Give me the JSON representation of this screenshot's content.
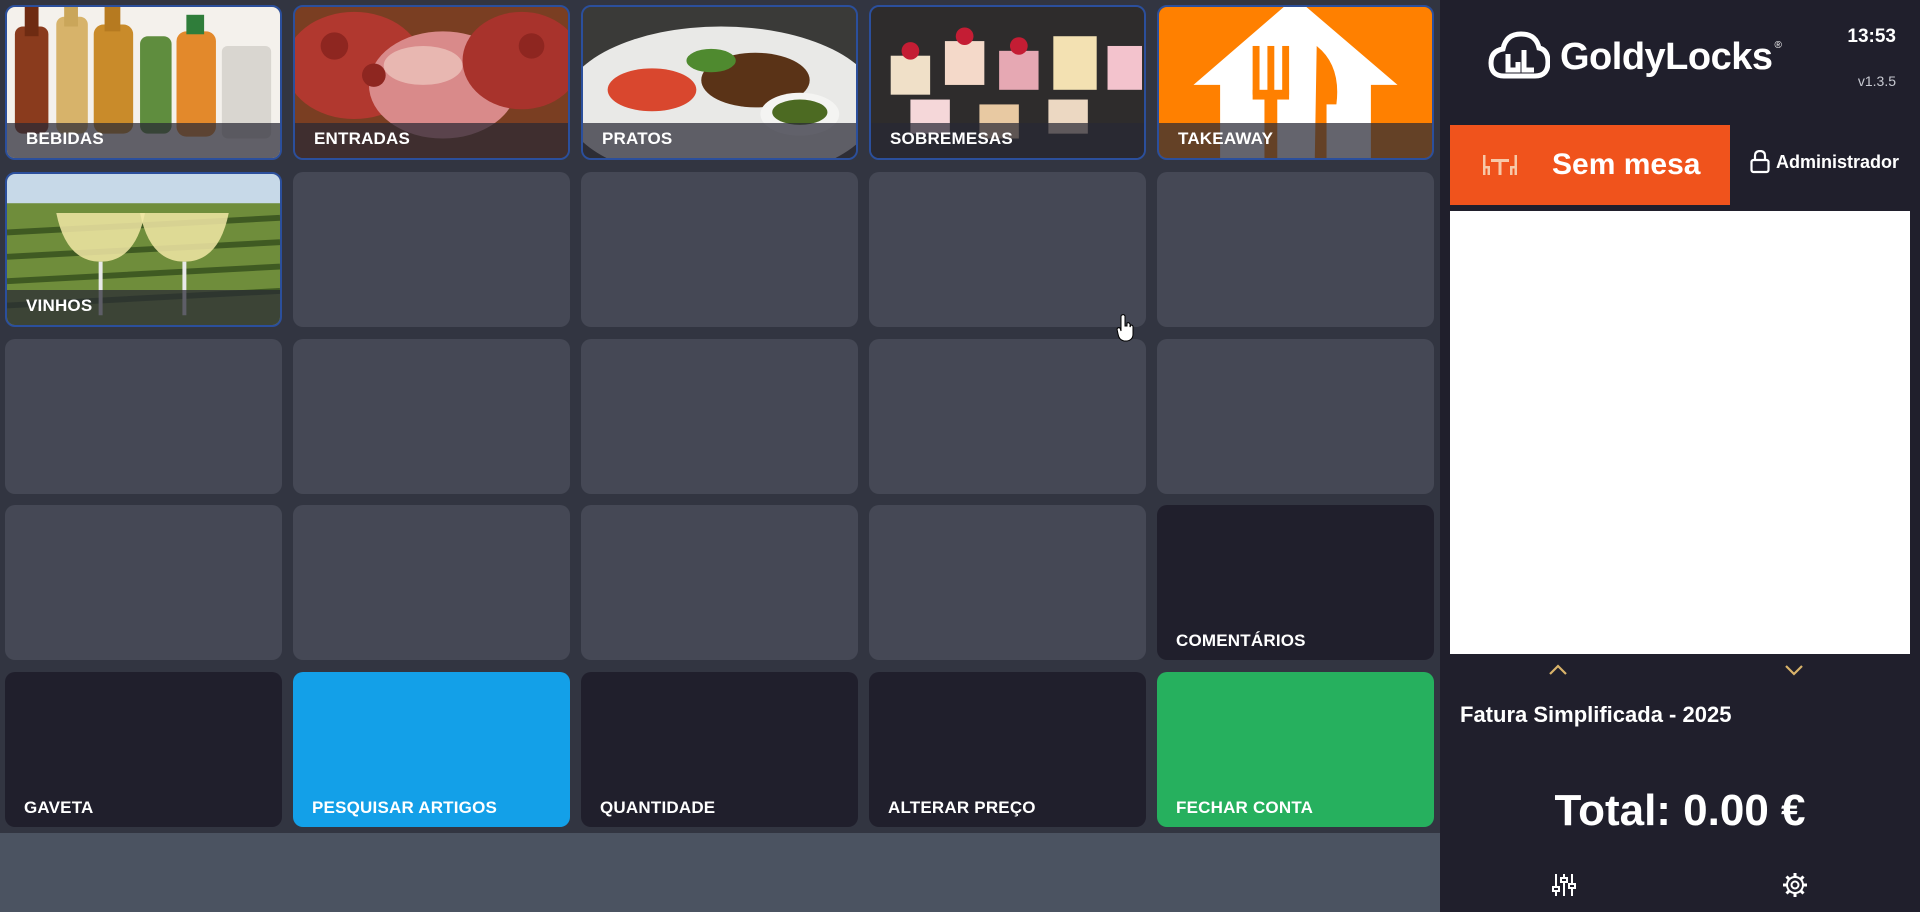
{
  "grid": {
    "tiles": [
      {
        "id": "bebidas",
        "label": "BEBIDAS",
        "kind": "image"
      },
      {
        "id": "entradas",
        "label": "ENTRADAS",
        "kind": "image"
      },
      {
        "id": "pratos",
        "label": "PRATOS",
        "kind": "image"
      },
      {
        "id": "sobremesas",
        "label": "SOBREMESAS",
        "kind": "image"
      },
      {
        "id": "takeaway",
        "label": "TAKEAWAY",
        "kind": "image"
      },
      {
        "id": "vinhos",
        "label": "VINHOS",
        "kind": "image"
      },
      {
        "id": "comentarios",
        "label": "COMENTÁRIOS",
        "kind": "dark"
      },
      {
        "id": "gaveta",
        "label": "GAVETA",
        "kind": "dark"
      },
      {
        "id": "pesquisar",
        "label": "PESQUISAR ARTIGOS",
        "kind": "blue"
      },
      {
        "id": "quantidade",
        "label": "QUANTIDADE",
        "kind": "dark"
      },
      {
        "id": "alterar-preco",
        "label": "ALTERAR PREÇO",
        "kind": "dark"
      },
      {
        "id": "fechar-conta",
        "label": "FECHAR CONTA",
        "kind": "green"
      }
    ]
  },
  "header": {
    "brand": "GoldyLocks",
    "brand_mark": "®",
    "time": "13:53",
    "version": "v1.3.5"
  },
  "order": {
    "table_label": "Sem mesa",
    "user_label": "Administrador",
    "document_type": "Fatura Simplificada - 2025",
    "total_label": "Total: 0.00 €"
  },
  "icons": {
    "table": "table-chairs-icon",
    "user_lock": "lock-icon",
    "scroll_up": "chevron-up-icon",
    "scroll_down": "chevron-down-icon",
    "filters": "sliders-icon",
    "settings": "gear-icon"
  },
  "colors": {
    "accent_orange": "#f0531c",
    "search_blue": "#13a0e8",
    "close_green": "#26b05e",
    "panel_dark": "#201f2c",
    "tile_empty": "#454855",
    "arrow_gold": "#d9b36a"
  }
}
